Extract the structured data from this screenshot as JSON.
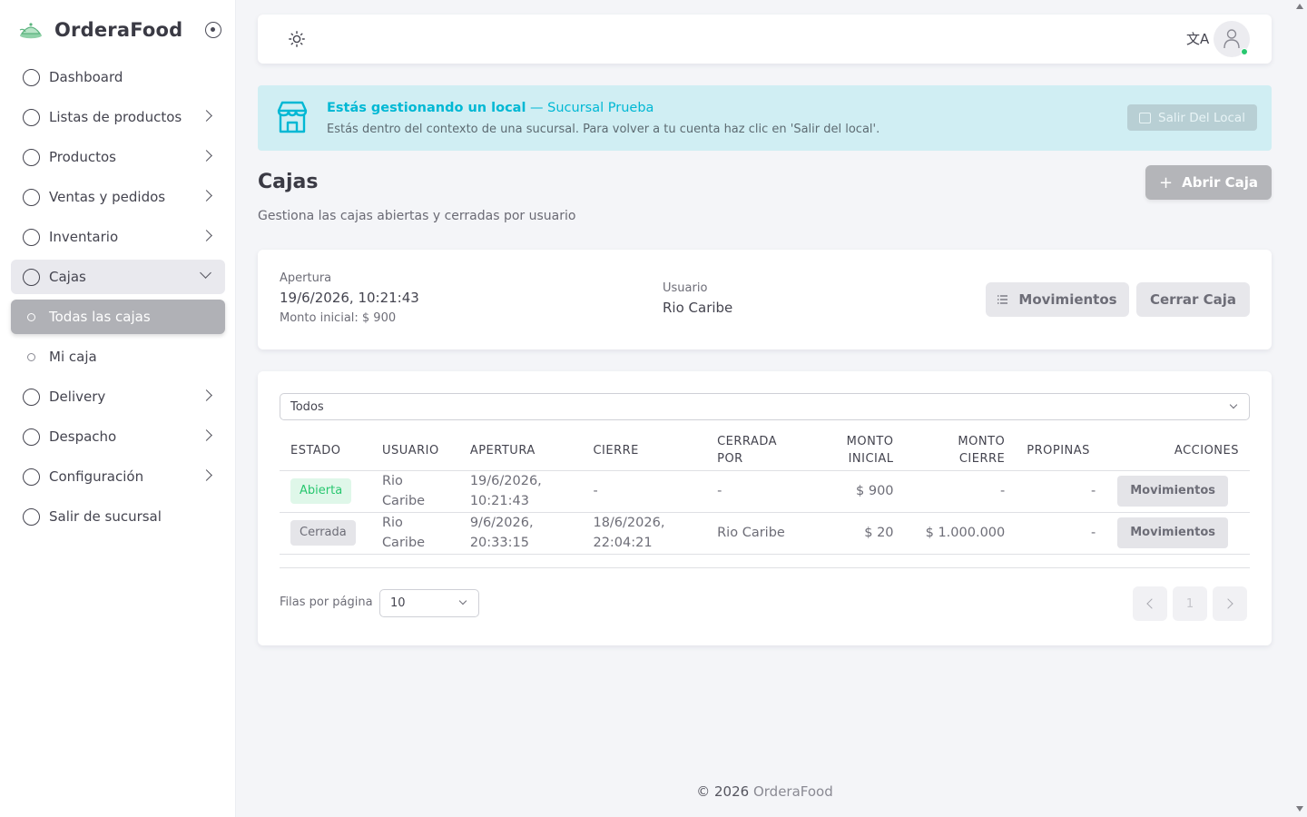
{
  "app": {
    "name": "OrderaFood"
  },
  "sidebar": {
    "items": [
      {
        "label": "Dashboard"
      },
      {
        "label": "Listas de productos"
      },
      {
        "label": "Productos"
      },
      {
        "label": "Ventas y pedidos"
      },
      {
        "label": "Inventario"
      },
      {
        "label": "Cajas"
      },
      {
        "label": "Todas las cajas"
      },
      {
        "label": "Mi caja"
      },
      {
        "label": "Delivery"
      },
      {
        "label": "Despacho"
      },
      {
        "label": "Configuración"
      },
      {
        "label": "Salir de sucursal"
      }
    ]
  },
  "topbar": {
    "translate_icon": "文A"
  },
  "alert": {
    "title": "Estás gestionando un local",
    "branch": "— Sucursal Prueba",
    "description": "Estás dentro del contexto de una sucursal. Para volver a tu cuenta haz clic en 'Salir del local'.",
    "button": "Salir Del Local"
  },
  "page": {
    "title": "Cajas",
    "subtitle": "Gestiona las cajas abiertas y cerradas por usuario",
    "open_button": "Abrir Caja"
  },
  "current_box": {
    "opening_label": "Apertura",
    "opening_value": "19/6/2026, 10:21:43",
    "initial_amount": "Monto inicial: $ 900",
    "user_label": "Usuario",
    "user_value": "Rio Caribe",
    "movements_button": "Movimientos",
    "close_button": "Cerrar Caja"
  },
  "filter": {
    "value": "Todos"
  },
  "table": {
    "headers": {
      "estado": "ESTADO",
      "usuario": "USUARIO",
      "apertura": "APERTURA",
      "cierre": "CIERRE",
      "cerrada_l1": "CERRADA",
      "cerrada_l2": "POR",
      "monto_inicial_l1": "MONTO",
      "monto_inicial_l2": "INICIAL",
      "monto_cierre_l1": "MONTO",
      "monto_cierre_l2": "CIERRE",
      "propinas": "PROPINAS",
      "acciones": "ACCIONES"
    },
    "rows": [
      {
        "estado": "Abierta",
        "usuario_l1": "Rio",
        "usuario_l2": "Caribe",
        "apertura_l1": "19/6/2026,",
        "apertura_l2": "10:21:43",
        "cierre": "-",
        "cerrada_por": "-",
        "monto_inicial": "$ 900",
        "monto_cierre": "-",
        "propinas": "-",
        "accion": "Movimientos"
      },
      {
        "estado": "Cerrada",
        "usuario_l1": "Rio",
        "usuario_l2": "Caribe",
        "apertura_l1": "9/6/2026,",
        "apertura_l2": "20:33:15",
        "cierre_l1": "18/6/2026,",
        "cierre_l2": "22:04:21",
        "cerrada_por": "Rio Caribe",
        "monto_inicial": "$ 20",
        "monto_cierre": "$ 1.000.000",
        "propinas": "-",
        "accion": "Movimientos"
      }
    ]
  },
  "pagination": {
    "rows_label": "Filas por página",
    "rows_value": "10",
    "page": "1"
  },
  "footer": {
    "copyright": "© 2026",
    "brand": "OrderaFood"
  },
  "colors": {
    "accent": "#00b8d4",
    "alert_bg": "#d0eef3",
    "success": "#28c76f"
  }
}
